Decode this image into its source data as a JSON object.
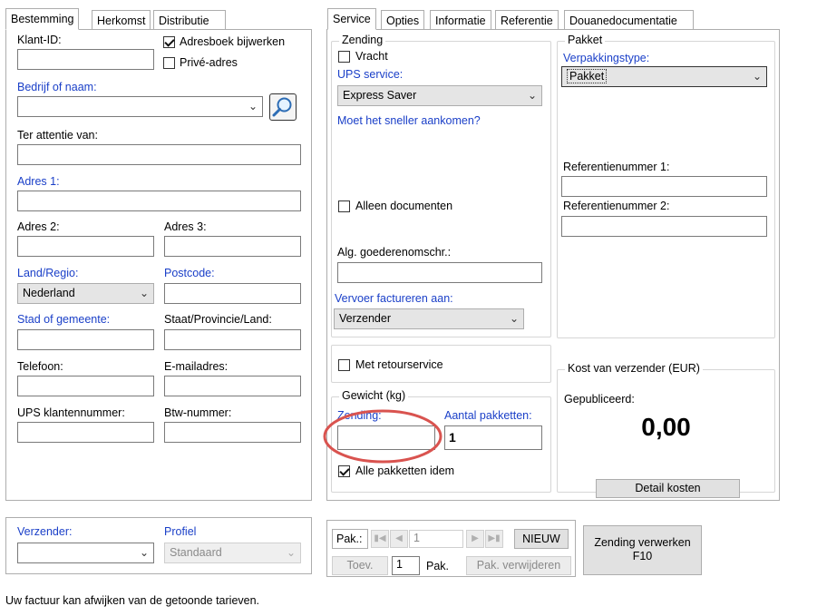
{
  "left_tabs": [
    "Bestemming",
    "Herkomst",
    "Distributie"
  ],
  "right_tabs": [
    "Service",
    "Opties",
    "Informatie",
    "Referentie",
    "Douanedocumentatie"
  ],
  "bestemming": {
    "klant_id_label": "Klant-ID:",
    "adresboek_label": "Adresboek bijwerken",
    "prive_label": "Privé-adres",
    "bedrijf_label": "Bedrijf of naam:",
    "attentie_label": "Ter attentie van:",
    "adres1_label": "Adres 1:",
    "adres2_label": "Adres 2:",
    "adres3_label": "Adres 3:",
    "land_label": "Land/Regio:",
    "land_value": "Nederland",
    "postcode_label": "Postcode:",
    "stad_label": "Stad of gemeente:",
    "staat_label": "Staat/Provincie/Land:",
    "telefoon_label": "Telefoon:",
    "email_label": "E-mailadres:",
    "ups_klant_label": "UPS klantennummer:",
    "btw_label": "Btw-nummer:"
  },
  "sender": {
    "verzender_label": "Verzender:",
    "profiel_label": "Profiel",
    "profiel_value": "Standaard"
  },
  "service": {
    "zending_group": "Zending",
    "vracht_label": "Vracht",
    "ups_service_label": "UPS service:",
    "ups_service_value": "Express Saver",
    "sneller_link": "Moet het sneller aankomen?",
    "alleen_documenten_label": "Alleen documenten",
    "goederen_label": "Alg. goederenomschr.:",
    "vervoer_label": "Vervoer factureren aan:",
    "vervoer_value": "Verzender",
    "retour_label": "Met retourservice",
    "gewicht_group": "Gewicht (kg)",
    "gewicht_zending_label": "Zending:",
    "aantal_label": "Aantal pakketten:",
    "aantal_value": "1",
    "alle_idem_label": "Alle pakketten idem",
    "pakket_group": "Pakket",
    "verpakking_label": "Verpakkingstype:",
    "verpakking_value": "Pakket",
    "ref1_label": "Referentienummer 1:",
    "ref2_label": "Referentienummer 2:",
    "kost_group": "Kost van verzender (EUR)",
    "gepubliceerd_label": "Gepubliceerd:",
    "amount": "0,00",
    "detail_button": "Detail kosten"
  },
  "pkg_nav": {
    "pak_label": "Pak.:",
    "pak_value": "1",
    "nieuw_button": "NIEUW",
    "toev_button": "Toev.",
    "count_value": "1",
    "pak_suffix": "Pak.",
    "verwijderen_button": "Pak. verwijderen"
  },
  "process_button": "Zending verwerken",
  "process_shortcut": "F10",
  "footer_note": "Uw factuur kan afwijken van de getoonde tarieven.",
  "icons": {
    "search": "magnifier-icon",
    "first": "first-page-icon",
    "prev": "prev-icon",
    "next": "next-icon",
    "last": "last-page-icon"
  },
  "colors": {
    "link_blue": "#1a3fc8",
    "highlight_circle": "#d9534f"
  }
}
